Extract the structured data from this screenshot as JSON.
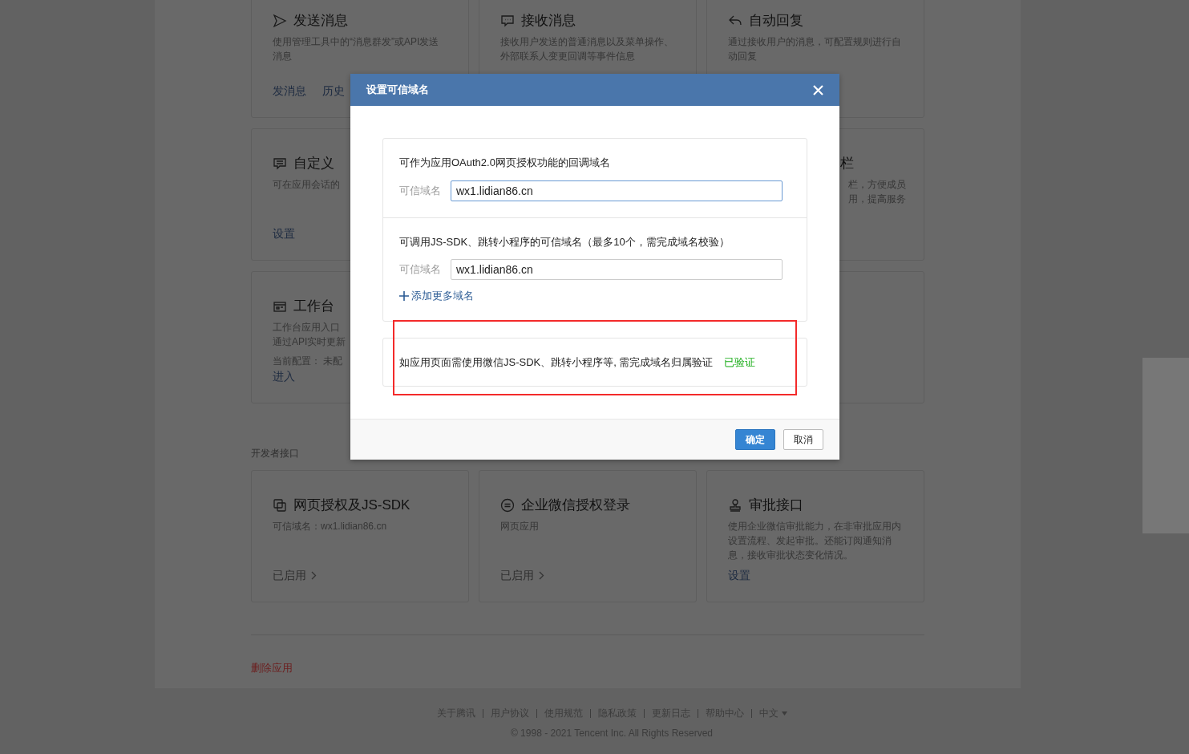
{
  "feature_rows": [
    {
      "left": {
        "title": "发送消息",
        "description": "使用管理工具中的“消息群发”或API发送消息",
        "links": [
          "发消息",
          "历史"
        ]
      },
      "middle": {
        "title": "接收消息",
        "description": "接收用户发送的普通消息以及菜单操作、外部联系人变更回调等事件信息"
      },
      "right": {
        "title": "自动回复",
        "description": "通过接收用户的消息，可配置规则进行自动回复"
      }
    },
    {
      "left": {
        "title": "自定义",
        "description": "可在应用会话的",
        "links": [
          "设置"
        ]
      },
      "right": {
        "title": "栏",
        "description_lines": [
          "栏，方便成员",
          "用，提高服务"
        ]
      }
    },
    {
      "left": {
        "title": "工作台",
        "description_lines": [
          "工作台应用入口",
          "通过API实时更新"
        ],
        "config": "当前配置： 未配",
        "links": [
          "进入"
        ]
      }
    }
  ],
  "developer_section": {
    "heading": "开发者接口",
    "cards": [
      {
        "title": "网页授权及JS-SDK",
        "description": "可信域名：wx1.lidian86.cn",
        "status": "已启用"
      },
      {
        "title": "企业微信授权登录",
        "description": "网页应用",
        "status": "已启用"
      },
      {
        "title": "审批接口",
        "description": "使用企业微信审批能力，在非审批应用内设置流程、发起审批。还能订阅通知消息，接收审批状态变化情况。",
        "links": [
          "设置"
        ]
      }
    ]
  },
  "delete_link": "删除应用",
  "footer": {
    "links": [
      "关于腾讯",
      "用户协议",
      "使用规范",
      "隐私政策",
      "更新日志",
      "帮助中心"
    ],
    "language": "中文",
    "copyright": "© 1998 - 2021 Tencent Inc. All Rights Reserved"
  },
  "dialog": {
    "title": "设置可信域名",
    "sections": [
      {
        "description": "可作为应用OAuth2.0网页授权功能的回调域名",
        "field_label": "可信域名",
        "value": "wx1.lidian86.cn",
        "focused": true
      },
      {
        "description": "可调用JS-SDK、跳转小程序的可信域名（最多10个，需完成域名校验）",
        "field_label": "可信域名",
        "value": "wx1.lidian86.cn",
        "focused": false,
        "add_link": "添加更多域名"
      }
    ],
    "verification": {
      "text": "如应用页面需使用微信JS-SDK、跳转小程序等, 需完成域名归属验证",
      "status": "已验证",
      "verified": true,
      "highlighted": true
    },
    "buttons": [
      {
        "label": "确定",
        "kind": "primary"
      },
      {
        "label": "取消",
        "kind": "secondary"
      }
    ]
  }
}
